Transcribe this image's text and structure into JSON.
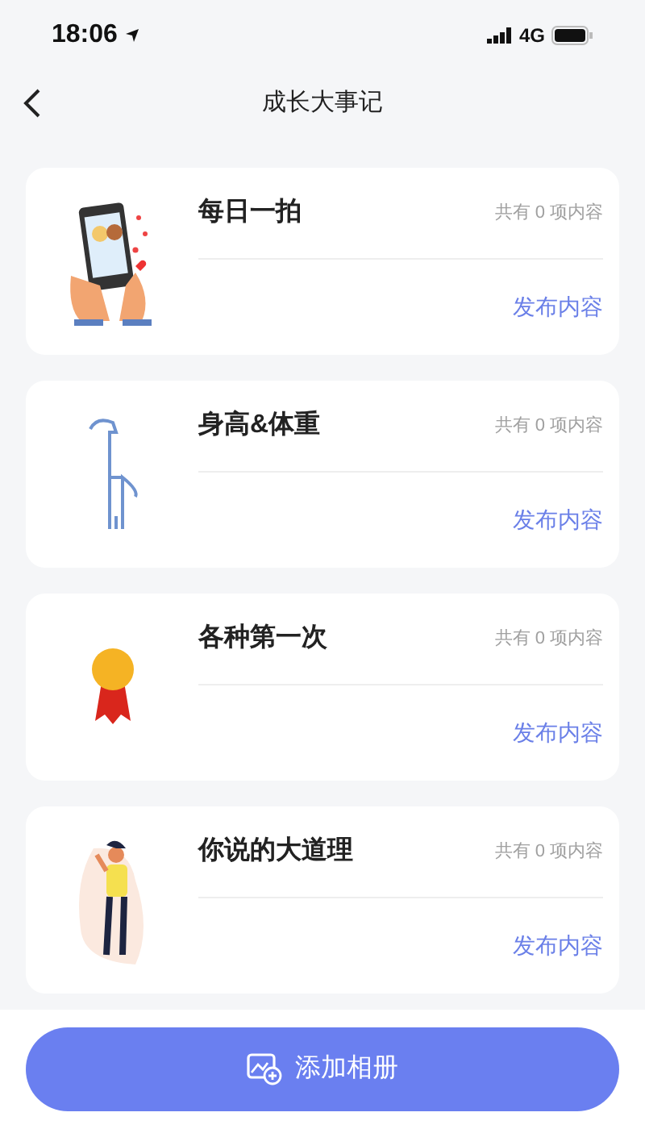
{
  "status_bar": {
    "time": "18:06",
    "network": "4G"
  },
  "nav": {
    "title": "成长大事记"
  },
  "cards": [
    {
      "title": "每日一拍",
      "count": "共有 0 项内容",
      "action": "发布内容"
    },
    {
      "title": "身高&体重",
      "count": "共有 0 项内容",
      "action": "发布内容"
    },
    {
      "title": "各种第一次",
      "count": "共有 0 项内容",
      "action": "发布内容"
    },
    {
      "title": "你说的大道理",
      "count": "共有 0 项内容",
      "action": "发布内容"
    }
  ],
  "bottom_button": {
    "label": "添加相册"
  }
}
